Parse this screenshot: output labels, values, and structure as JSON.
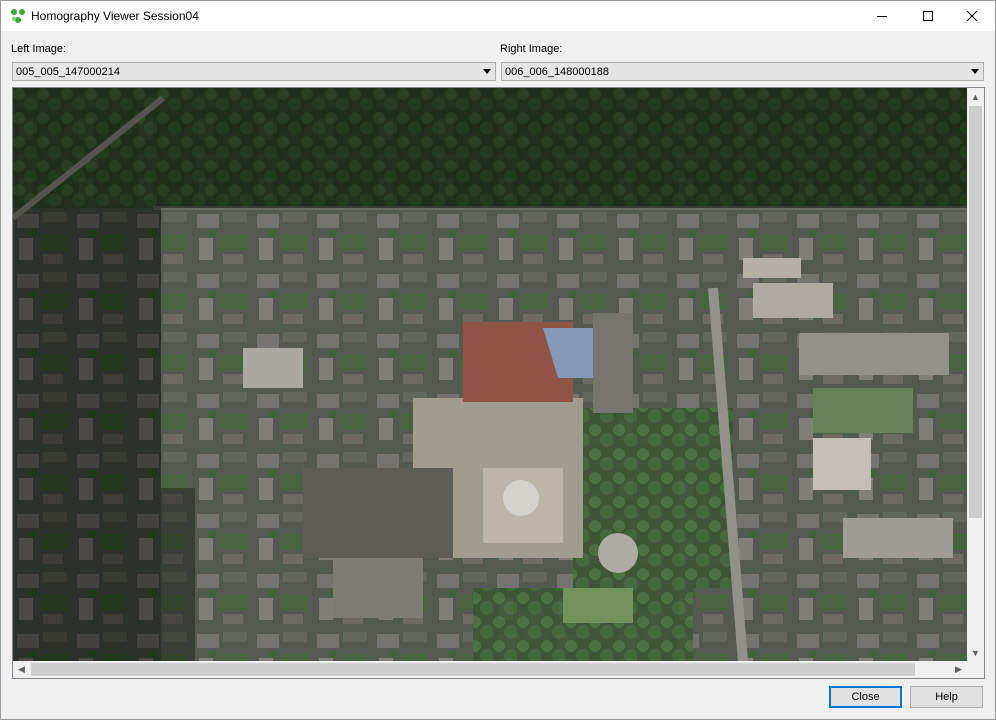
{
  "window": {
    "title": "Homography Viewer Session04",
    "icon": "three-dots-graph-icon",
    "accent": "#0078d7"
  },
  "left": {
    "label": "Left Image:",
    "selected": "005_005_147000214"
  },
  "right": {
    "label": "Right Image:",
    "selected": "006_006_148000188"
  },
  "viewer": {
    "content": "aerial-city-overlay"
  },
  "buttons": {
    "close": "Close",
    "help": "Help"
  }
}
